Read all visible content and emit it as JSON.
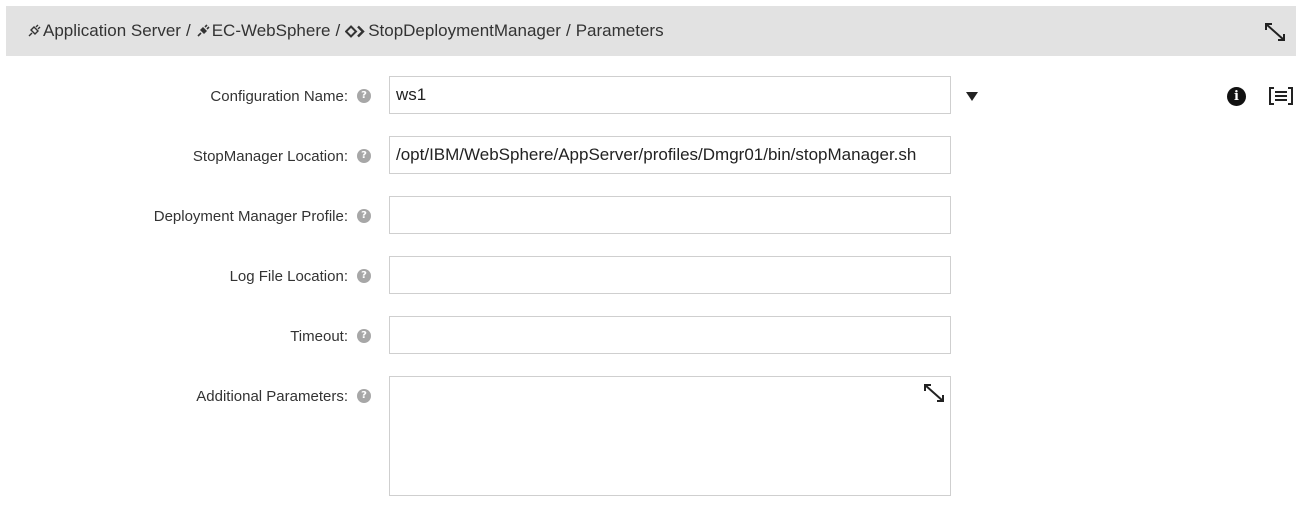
{
  "breadcrumb": {
    "items": [
      "Application Server",
      "EC-WebSphere",
      "StopDeploymentManager",
      "Parameters"
    ],
    "separator": "/",
    "icons": [
      "plug-icon",
      "plugin-icon",
      "procedure-icon"
    ]
  },
  "form": {
    "help_glyph": "?",
    "fields": [
      {
        "label": "Configuration Name:",
        "value": "ws1",
        "type": "select"
      },
      {
        "label": "StopManager Location:",
        "value": "/opt/IBM/WebSphere/AppServer/profiles/Dmgr01/bin/stopManager.sh",
        "type": "text"
      },
      {
        "label": "Deployment Manager Profile:",
        "value": "",
        "type": "text"
      },
      {
        "label": "Log File Location:",
        "value": "",
        "type": "text"
      },
      {
        "label": "Timeout:",
        "value": "",
        "type": "text"
      },
      {
        "label": "Additional Parameters:",
        "value": "",
        "type": "textarea"
      }
    ]
  },
  "actions": {
    "info_glyph": "i",
    "icons": [
      "expand-icon",
      "dropdown-arrow-icon",
      "info-icon",
      "list-icon"
    ]
  }
}
